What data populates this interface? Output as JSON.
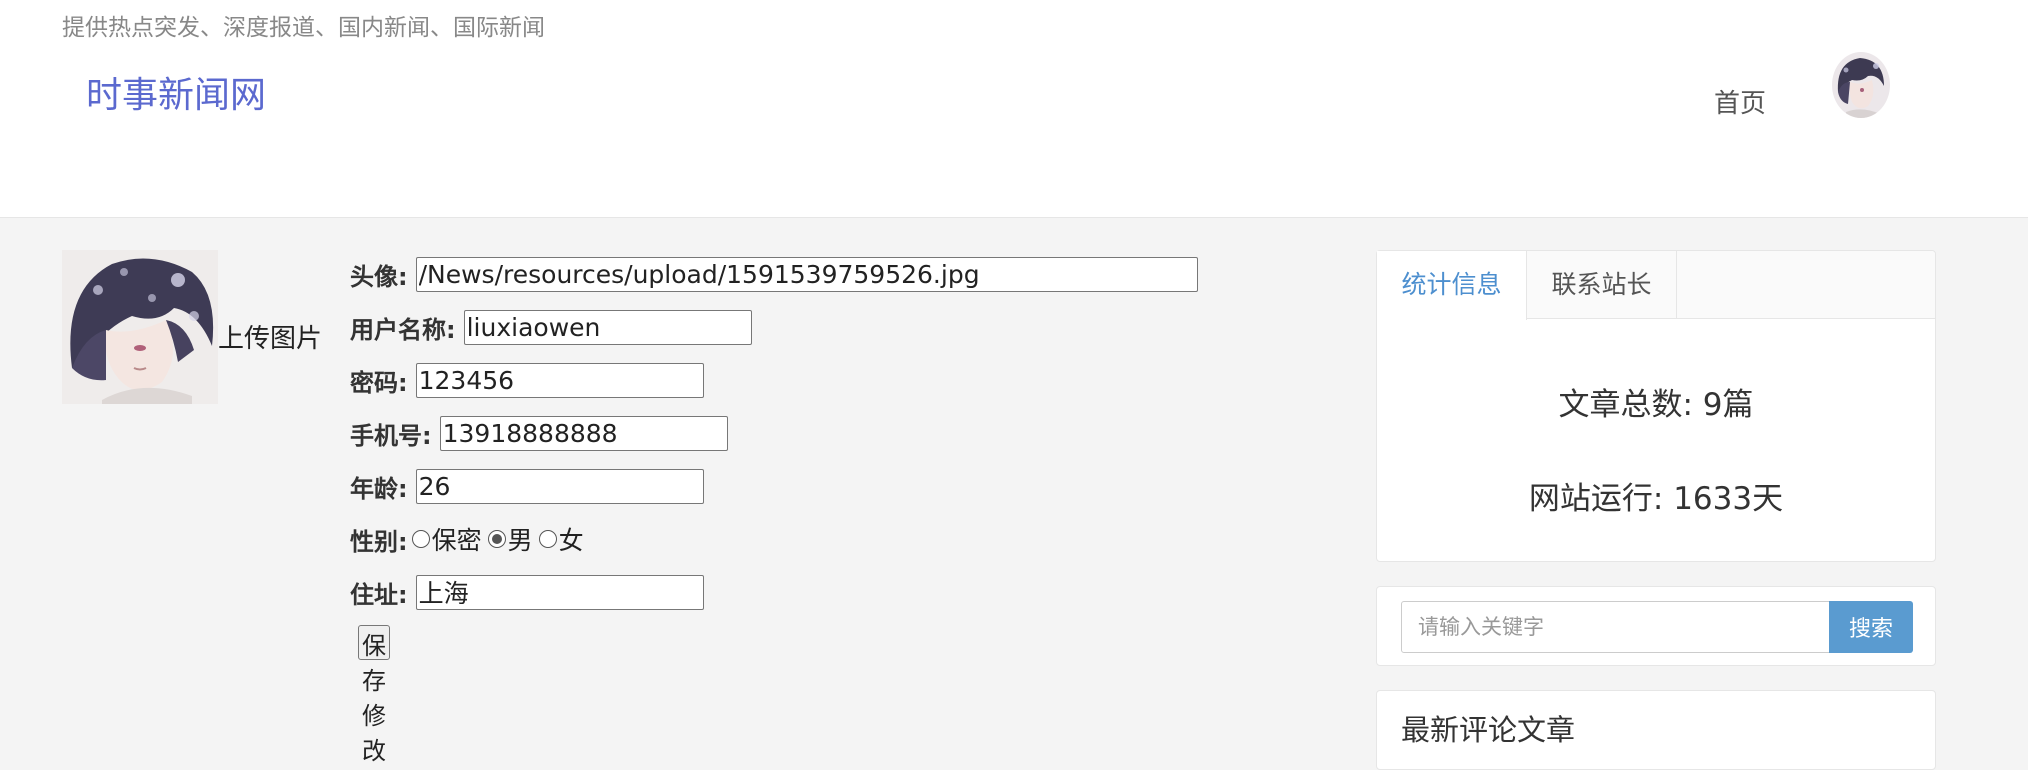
{
  "header": {
    "tagline": "提供热点突发、深度报道、国内新闻、国际新闻",
    "site_title": "时事新闻网",
    "nav_home": "首页"
  },
  "profile": {
    "upload_label": "上传图片",
    "fields": {
      "avatar": {
        "label": "头像:",
        "value": "/News/resources/upload/1591539759526.jpg"
      },
      "username": {
        "label": "用户名称:",
        "value": "liuxiaowen"
      },
      "password": {
        "label": "密码:",
        "value": "123456"
      },
      "phone": {
        "label": "手机号:",
        "value": "13918888888"
      },
      "age": {
        "label": "年龄:",
        "value": "26"
      },
      "gender": {
        "label": "性别:",
        "options": [
          "保密",
          "男",
          "女"
        ],
        "selected": "男"
      },
      "address": {
        "label": "住址:",
        "value": "上海"
      }
    },
    "save_label": "保存修改"
  },
  "sidebar": {
    "tabs": [
      "统计信息",
      "联系站长"
    ],
    "active_tab": "统计信息",
    "stats": {
      "articles": "文章总数: 9篇",
      "uptime": "网站运行: 1633天"
    },
    "search": {
      "placeholder": "请输入关键字",
      "button_label": "搜索"
    },
    "comments_title": "最新评论文章"
  },
  "colors": {
    "brand": "#5b69cf",
    "accent": "#5a9bd0",
    "active_tab": "#4d8fcf"
  }
}
